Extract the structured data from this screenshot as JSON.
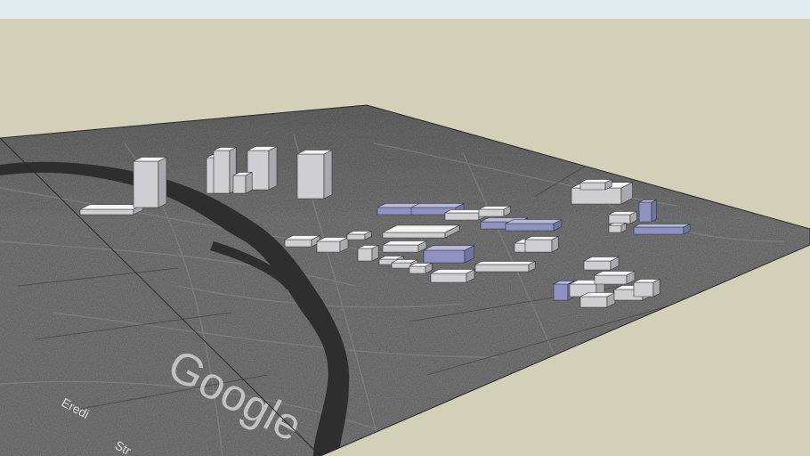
{
  "viewport": {
    "sky_color": "#e2ecec",
    "ground_color": "#d2d0b8"
  },
  "terrain": {
    "imagery_watermark": "Google",
    "street_label": "Eredi",
    "street_label_2": "Str",
    "base_color": "#5a5a5a",
    "river_color": "#2e2e2e"
  },
  "building_colors": {
    "white_top": "#f4f4f4",
    "white_side": "#cfcfd2",
    "white_dark": "#a9a9ae",
    "blue_top": "#b6b8dc",
    "blue_side": "#8f92c0",
    "blue_dark": "#70739f"
  }
}
